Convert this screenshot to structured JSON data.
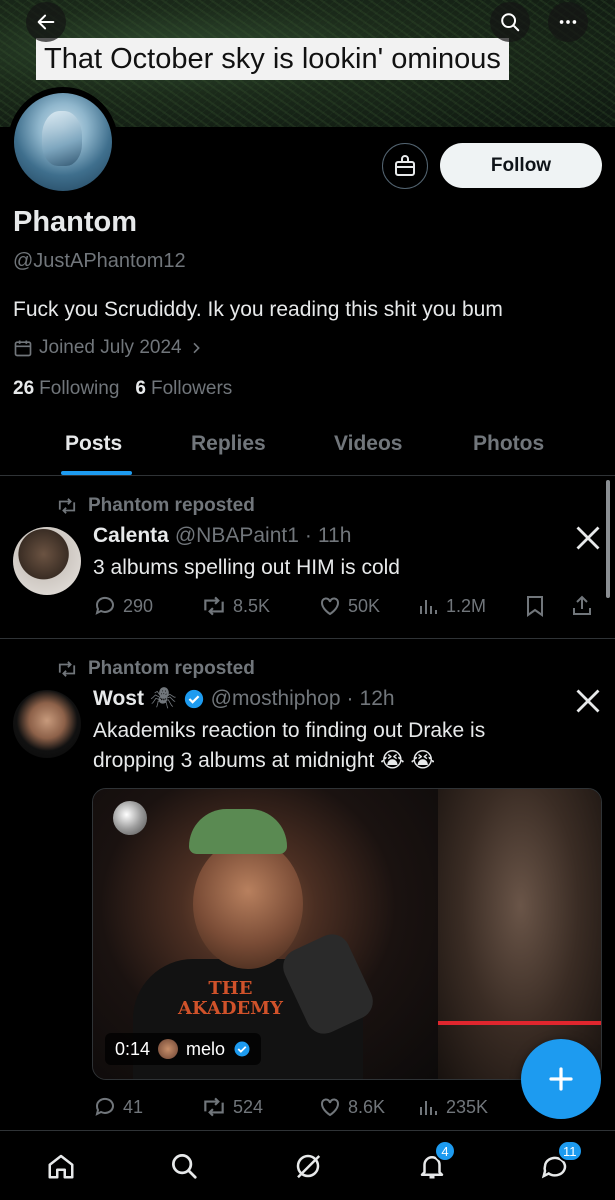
{
  "banner": {
    "caption": "That October sky is lookin' ominous"
  },
  "profile": {
    "name": "Phantom",
    "handle": "@JustAPhantom12",
    "bio": "Fuck you Scrudiddy. Ik you reading this shit you bum",
    "joined": "Joined July 2024",
    "following_count": "26",
    "following_label": "Following",
    "followers_count": "6",
    "followers_label": "Followers",
    "follow_label": "Follow"
  },
  "tabs": [
    {
      "label": "Posts",
      "active": true
    },
    {
      "label": "Replies",
      "active": false
    },
    {
      "label": "Videos",
      "active": false
    },
    {
      "label": "Photos",
      "active": false
    }
  ],
  "posts": [
    {
      "repost_label": "Phantom reposted",
      "name": "Calenta",
      "handle": "@NBAPaint1",
      "dot": "·",
      "time": "11h",
      "text": "3 albums spelling out HIM is cold",
      "replies": "290",
      "reposts": "8.5K",
      "likes": "50K",
      "views": "1.2M"
    },
    {
      "repost_label": "Phantom reposted",
      "name": "Wost",
      "name_emoji": "🕷",
      "handle": "@mosthiphop",
      "dot": "·",
      "time": "12h",
      "text": "Akademiks reaction to finding out Drake is dropping 3 albums at midnight 😭 😭",
      "video_time": "0:14",
      "video_user": "melo",
      "hoodie_text_1": "THE",
      "hoodie_text_2": "AKADEMY",
      "replies": "41",
      "reposts": "524",
      "likes": "8.6K",
      "views": "235K"
    }
  ],
  "nav": {
    "notifications_badge": "4",
    "messages_badge": "11"
  },
  "colors": {
    "accent": "#1d9bf0",
    "background": "#000000",
    "muted": "#71767b"
  }
}
